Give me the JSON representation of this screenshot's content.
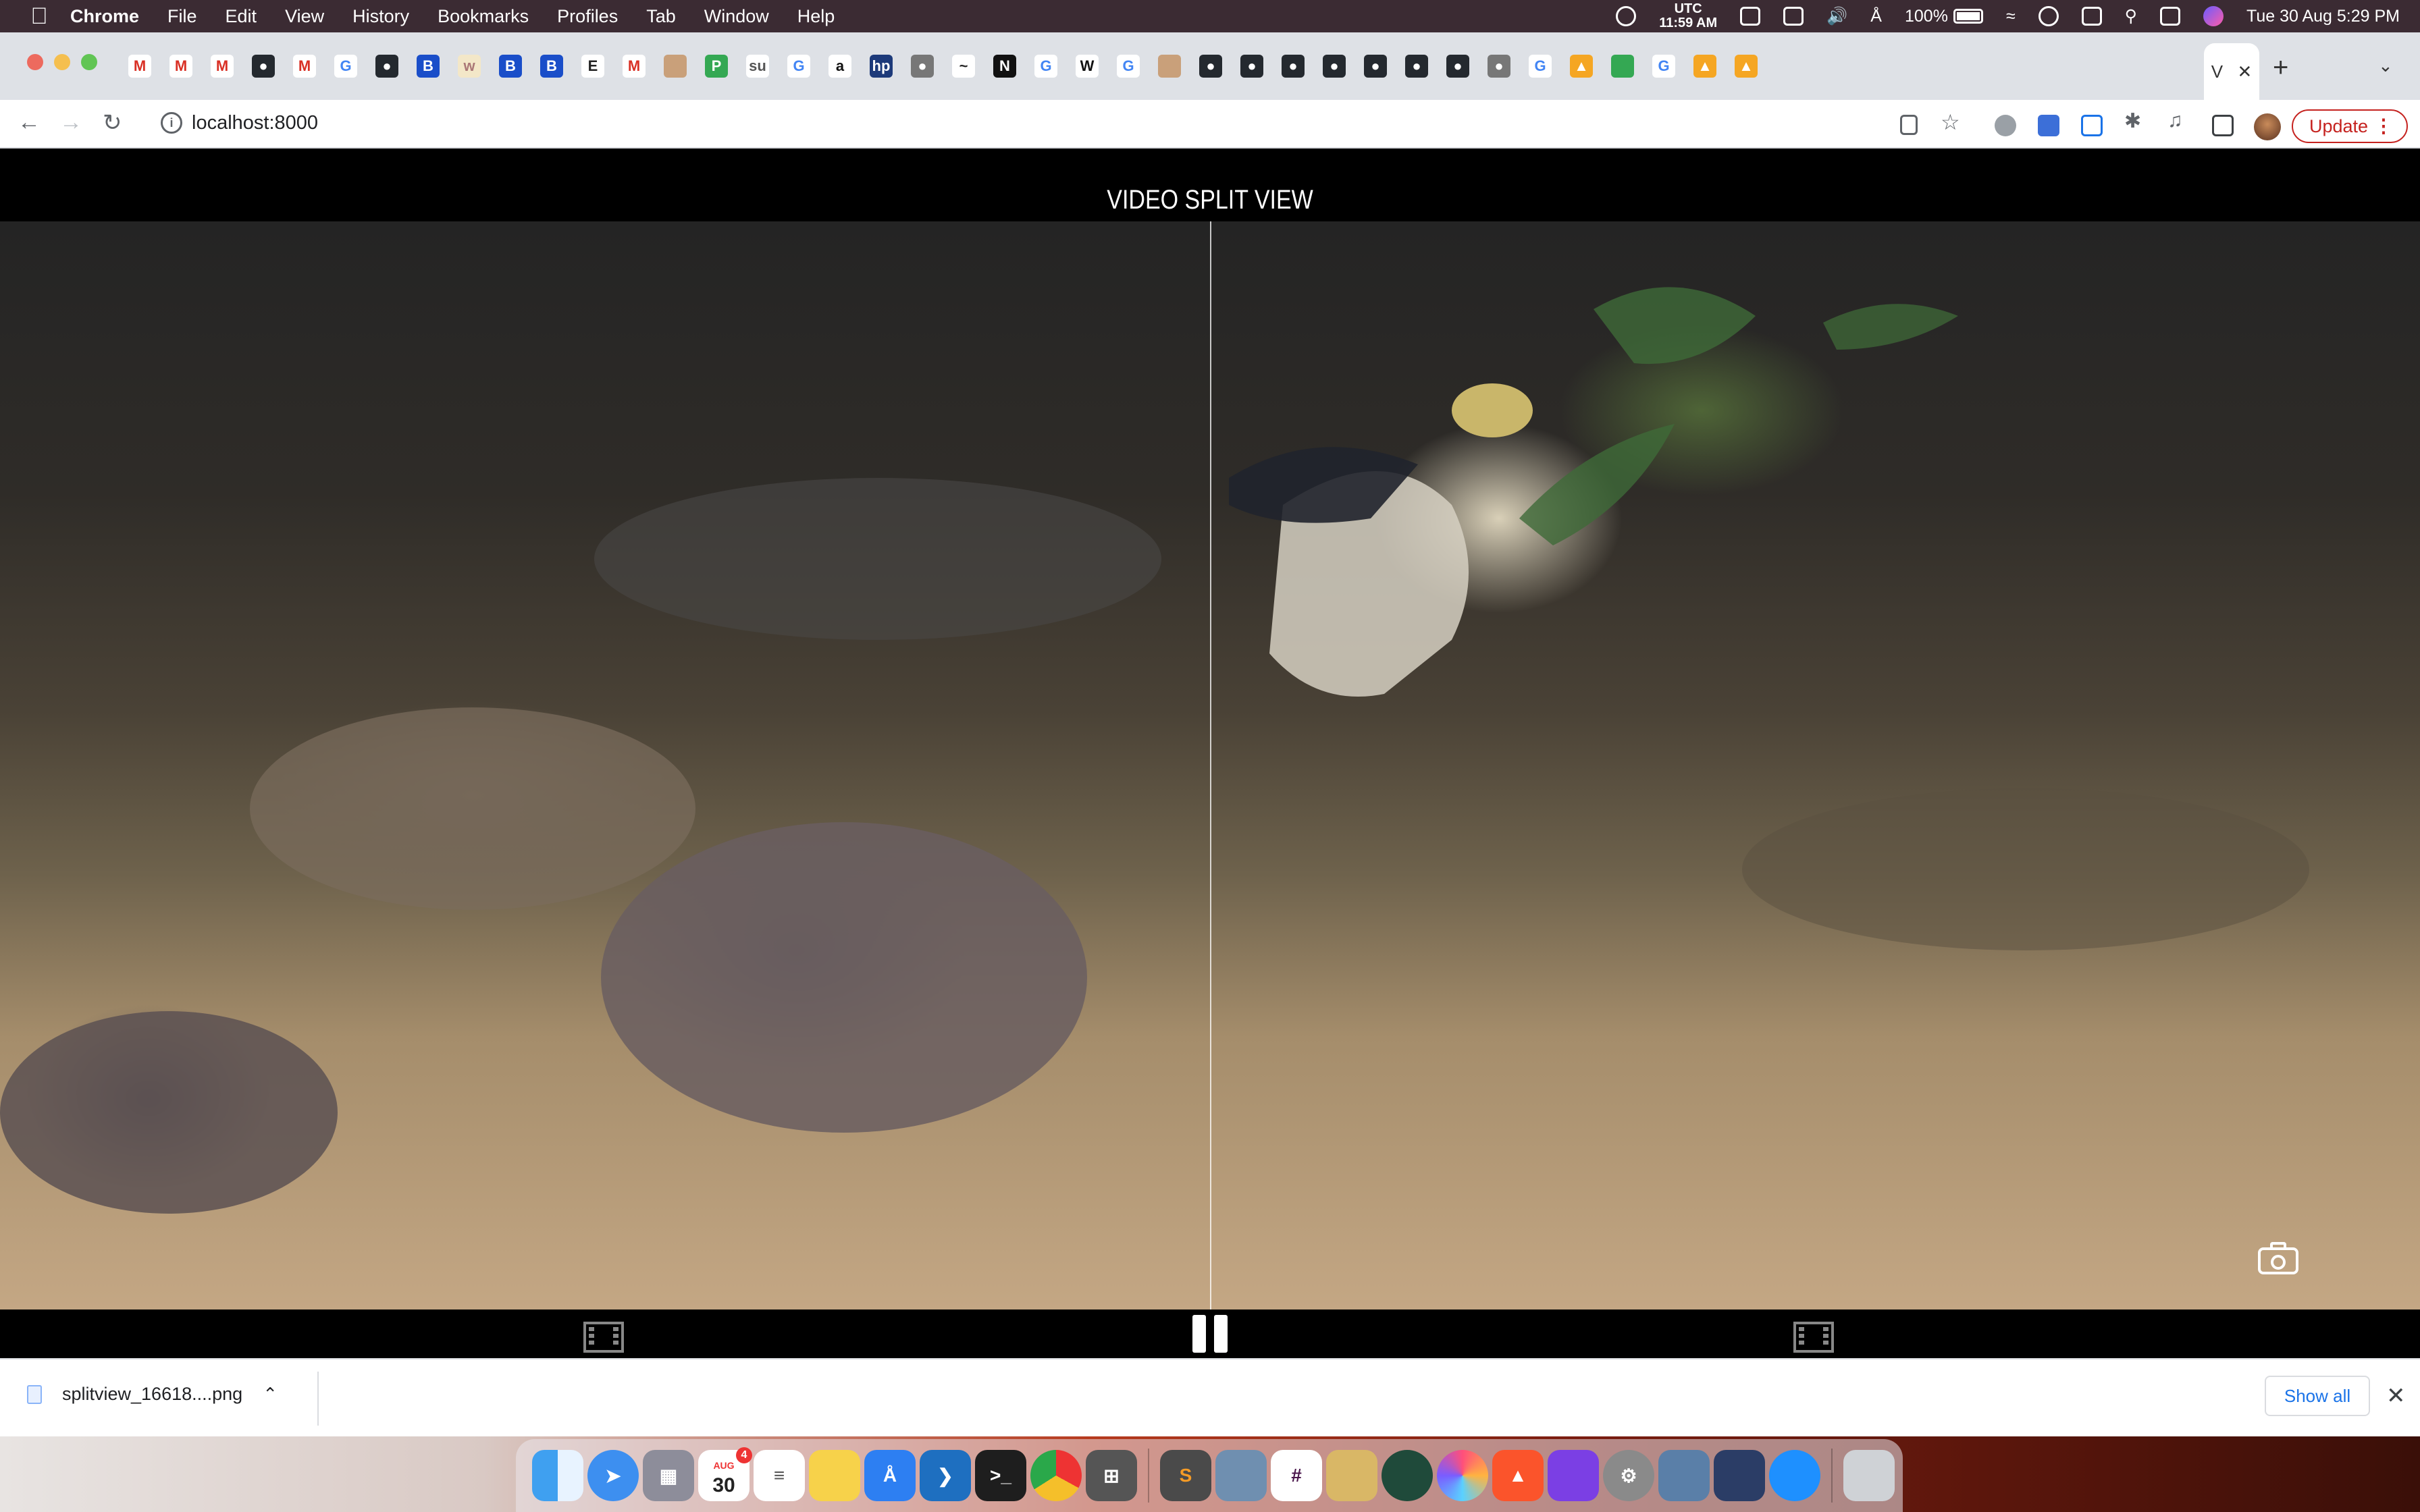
{
  "menubar": {
    "app_name": "Chrome",
    "items": [
      "File",
      "Edit",
      "View",
      "History",
      "Bookmarks",
      "Profiles",
      "Tab",
      "Window",
      "Help"
    ],
    "clock_tz": "UTC",
    "clock_time": "11:59 AM",
    "battery": "100%",
    "datetime": "Tue 30 Aug  5:29 PM"
  },
  "browser": {
    "url": "localhost:8000",
    "update_label": "Update",
    "active_tab_title": "V",
    "tab_favicons": [
      "M",
      "M",
      "M",
      "gh",
      "M",
      "G",
      "gh",
      "B",
      "w",
      "B",
      "B",
      "E",
      "M",
      "face",
      "P",
      "SU",
      "G",
      "a",
      "hp",
      "globe",
      "aa",
      "N",
      "G",
      "W",
      "G",
      "face",
      "gh",
      "gh",
      "gh",
      "gh",
      "gh",
      "gh",
      "gh",
      "globe",
      "G",
      "warn",
      "green",
      "G",
      "warn",
      "warn"
    ]
  },
  "page": {
    "title": "VIDEO SPLIT VIEW"
  },
  "downloads": {
    "filename": "splitview_16618....png",
    "show_all": "Show all"
  },
  "dock": {
    "calendar_month": "AUG",
    "calendar_day": "30",
    "calendar_badge": "4"
  },
  "colors": {
    "menubar": "#3b2b33",
    "tabstrip": "#dee1e6",
    "update": "#c5221f",
    "link": "#1a73e8"
  }
}
